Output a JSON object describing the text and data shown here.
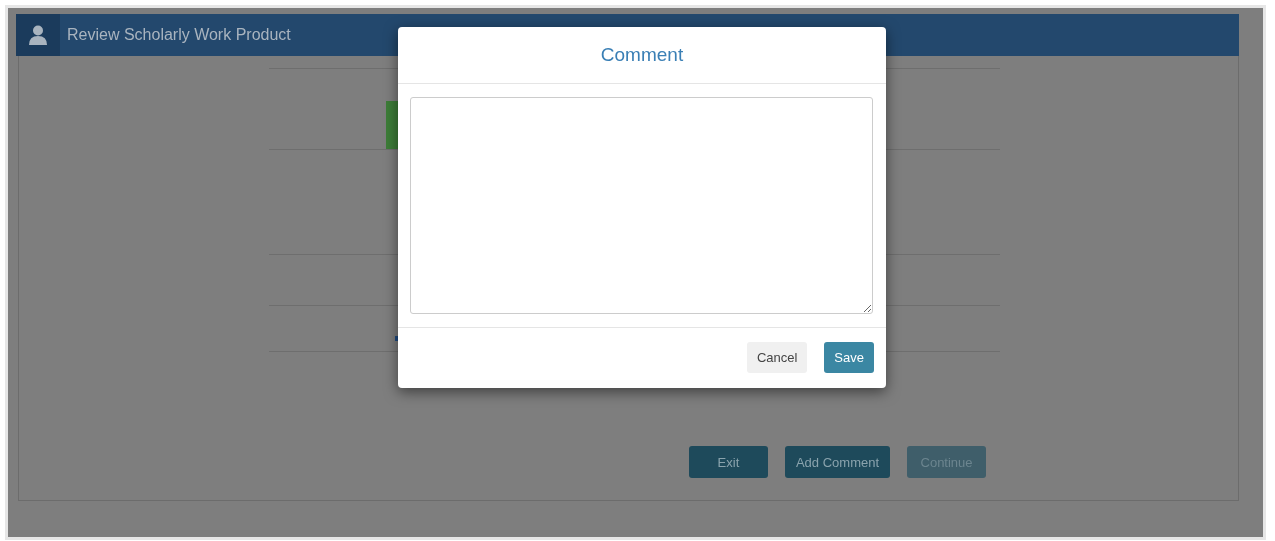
{
  "header": {
    "title": "Review Scholarly Work Product"
  },
  "actions": [
    {
      "label": "Exit",
      "disabled": false
    },
    {
      "label": "Add Comment",
      "disabled": false
    },
    {
      "label": "Continue",
      "disabled": true
    }
  ],
  "dialog": {
    "title": "Comment",
    "buttons": [
      {
        "label": "Cancel",
        "kind": "secondary"
      },
      {
        "label": "Save",
        "kind": "primary"
      }
    ]
  }
}
